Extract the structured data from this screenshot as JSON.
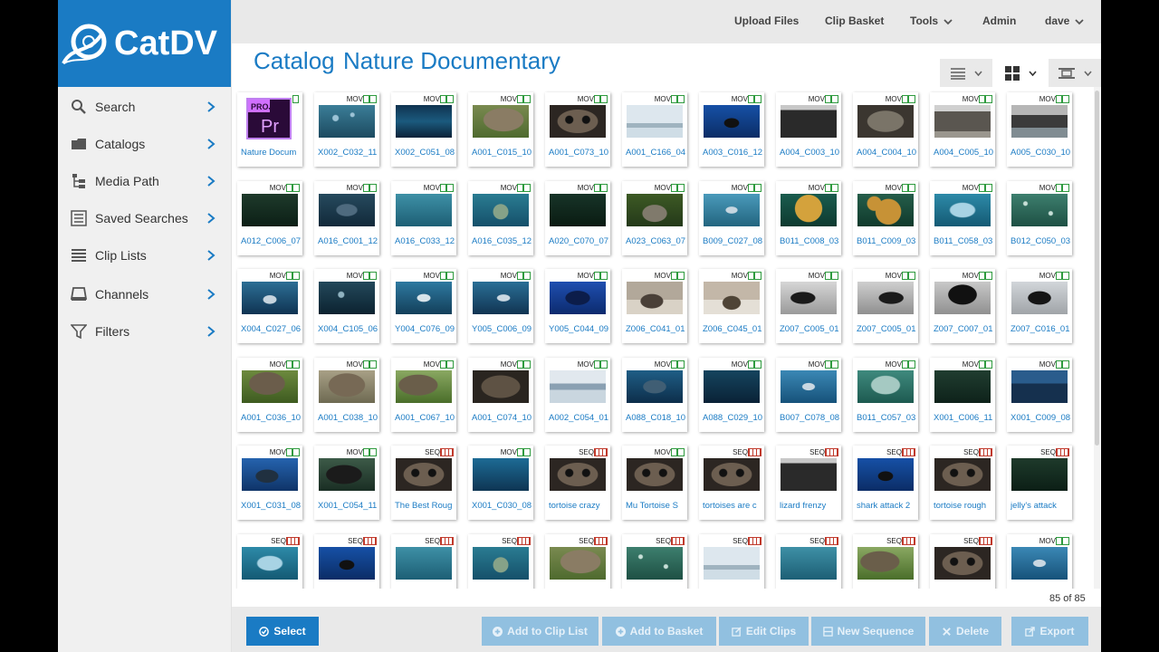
{
  "app": {
    "brand": "CatDV"
  },
  "topnav": {
    "upload": "Upload Files",
    "basket": "Clip Basket",
    "tools": "Tools",
    "admin": "Admin",
    "user": "dave"
  },
  "sidebar": {
    "items": [
      {
        "label": "Search",
        "icon": "search-icon"
      },
      {
        "label": "Catalogs",
        "icon": "catalogs-icon"
      },
      {
        "label": "Media Path",
        "icon": "media-path-icon"
      },
      {
        "label": "Saved Searches",
        "icon": "saved-searches-icon"
      },
      {
        "label": "Clip Lists",
        "icon": "clip-lists-icon"
      },
      {
        "label": "Channels",
        "icon": "channels-icon"
      },
      {
        "label": "Filters",
        "icon": "filter-icon"
      }
    ]
  },
  "header": {
    "crumb": "Catalog",
    "title": "Nature Documentary"
  },
  "clips": [
    {
      "name": "Nature Docum",
      "type": "PROJ",
      "thumb": "proj"
    },
    {
      "name": "X002_C032_11",
      "type": "MOV",
      "thumb": "fish"
    },
    {
      "name": "X002_C051_08",
      "type": "MOV",
      "thumb": "deepblue"
    },
    {
      "name": "A001_C015_10",
      "type": "MOV",
      "thumb": "tortoise"
    },
    {
      "name": "A001_C073_10",
      "type": "MOV",
      "thumb": "face"
    },
    {
      "name": "A001_C166_04",
      "type": "MOV",
      "thumb": "mist"
    },
    {
      "name": "A003_C016_12",
      "type": "MOV",
      "thumb": "diver"
    },
    {
      "name": "A004_C003_10",
      "type": "MOV",
      "thumb": "rock"
    },
    {
      "name": "A004_C004_10",
      "type": "MOV",
      "thumb": "iguana"
    },
    {
      "name": "A004_C005_10",
      "type": "MOV",
      "thumb": "claw"
    },
    {
      "name": "A005_C030_10",
      "type": "MOV",
      "thumb": "rocksea"
    },
    {
      "name": "A012_C006_07",
      "type": "MOV",
      "thumb": "darkgreen"
    },
    {
      "name": "A016_C001_12",
      "type": "MOV",
      "thumb": "shark"
    },
    {
      "name": "A016_C033_12",
      "type": "MOV",
      "thumb": "teal"
    },
    {
      "name": "A016_C035_12",
      "type": "MOV",
      "thumb": "teal2"
    },
    {
      "name": "A020_C070_07",
      "type": "MOV",
      "thumb": "darkgreen2"
    },
    {
      "name": "A023_C063_07",
      "type": "MOV",
      "thumb": "seal"
    },
    {
      "name": "B009_C027_08",
      "type": "MOV",
      "thumb": "shark2"
    },
    {
      "name": "B011_C008_03",
      "type": "MOV",
      "thumb": "jelly"
    },
    {
      "name": "B011_C009_03",
      "type": "MOV",
      "thumb": "jelly2"
    },
    {
      "name": "B011_C058_03",
      "type": "MOV",
      "thumb": "jellyblue"
    },
    {
      "name": "B012_C050_03",
      "type": "MOV",
      "thumb": "bubbles"
    },
    {
      "name": "X004_C027_06",
      "type": "MOV",
      "thumb": "shark3"
    },
    {
      "name": "X004_C105_06",
      "type": "MOV",
      "thumb": "fish2"
    },
    {
      "name": "Y004_C076_09",
      "type": "MOV",
      "thumb": "shark4"
    },
    {
      "name": "Y005_C006_09",
      "type": "MOV",
      "thumb": "shark5"
    },
    {
      "name": "Y005_C044_09",
      "type": "MOV",
      "thumb": "manta"
    },
    {
      "name": "Z006_C041_01",
      "type": "MOV",
      "thumb": "sealice"
    },
    {
      "name": "Z006_C045_01",
      "type": "MOV",
      "thumb": "sealice2"
    },
    {
      "name": "Z007_C005_01",
      "type": "MOV",
      "thumb": "penguin"
    },
    {
      "name": "Z007_C005_01",
      "type": "MOV",
      "thumb": "penguin2"
    },
    {
      "name": "Z007_C007_01",
      "type": "MOV",
      "thumb": "penguin3"
    },
    {
      "name": "Z007_C016_01",
      "type": "MOV",
      "thumb": "penguin4"
    },
    {
      "name": "A001_C036_10",
      "type": "MOV",
      "thumb": "tortoise2"
    },
    {
      "name": "A001_C038_10",
      "type": "MOV",
      "thumb": "tortoise3"
    },
    {
      "name": "A001_C067_10",
      "type": "MOV",
      "thumb": "tortoise4"
    },
    {
      "name": "A001_C074_10",
      "type": "MOV",
      "thumb": "face2"
    },
    {
      "name": "A002_C054_01",
      "type": "MOV",
      "thumb": "bird"
    },
    {
      "name": "A088_C018_10",
      "type": "MOV",
      "thumb": "whaleshark"
    },
    {
      "name": "A088_C029_10",
      "type": "MOV",
      "thumb": "deepblue2"
    },
    {
      "name": "B007_C078_08",
      "type": "MOV",
      "thumb": "shark6"
    },
    {
      "name": "B011_C057_03",
      "type": "MOV",
      "thumb": "jellyclear"
    },
    {
      "name": "X001_C006_11",
      "type": "MOV",
      "thumb": "darkgreen3"
    },
    {
      "name": "X001_C009_08",
      "type": "MOV",
      "thumb": "reef"
    },
    {
      "name": "X001_C031_08",
      "type": "MOV",
      "thumb": "manta2"
    },
    {
      "name": "X001_C054_11",
      "type": "MOV",
      "thumb": "sealion"
    },
    {
      "name": "The Best Roug",
      "type": "SEQ",
      "thumb": "face"
    },
    {
      "name": "X001_C030_08",
      "type": "MOV",
      "thumb": "deepblue3"
    },
    {
      "name": "tortoise crazy",
      "type": "SEQ",
      "thumb": "face"
    },
    {
      "name": "Mu Tortoise S",
      "type": "MOV",
      "thumb": "face"
    },
    {
      "name": "tortoises are c",
      "type": "SEQ",
      "thumb": "face"
    },
    {
      "name": "lizard frenzy",
      "type": "SEQ",
      "thumb": "rock"
    },
    {
      "name": "shark attack 2",
      "type": "SEQ",
      "thumb": "diver"
    },
    {
      "name": "tortoise rough",
      "type": "SEQ",
      "thumb": "face"
    },
    {
      "name": "jelly's attack",
      "type": "SEQ",
      "thumb": "darkgreen"
    },
    {
      "name": "",
      "type": "SEQ",
      "thumb": "jellyblue"
    },
    {
      "name": "",
      "type": "SEQ",
      "thumb": "diver"
    },
    {
      "name": "",
      "type": "SEQ",
      "thumb": "teal"
    },
    {
      "name": "",
      "type": "SEQ",
      "thumb": "teal2"
    },
    {
      "name": "",
      "type": "SEQ",
      "thumb": "tortoise"
    },
    {
      "name": "",
      "type": "SEQ",
      "thumb": "bubbles"
    },
    {
      "name": "",
      "type": "SEQ",
      "thumb": "mist"
    },
    {
      "name": "",
      "type": "SEQ",
      "thumb": "teal"
    },
    {
      "name": "",
      "type": "SEQ",
      "thumb": "tortoise4"
    },
    {
      "name": "",
      "type": "SEQ",
      "thumb": "face"
    },
    {
      "name": "",
      "type": "MOV",
      "thumb": "shark6"
    }
  ],
  "status": {
    "count": "85 of 85"
  },
  "actions": {
    "select": "Select",
    "add_clip_list": "Add to Clip List",
    "add_basket": "Add to Basket",
    "edit": "Edit Clips",
    "new_sequence": "New Sequence",
    "delete": "Delete",
    "export": "Export"
  },
  "colors": {
    "accent": "#1a7bc4",
    "mov_badge": "#2e9a3e",
    "seq_badge": "#c0392b"
  }
}
